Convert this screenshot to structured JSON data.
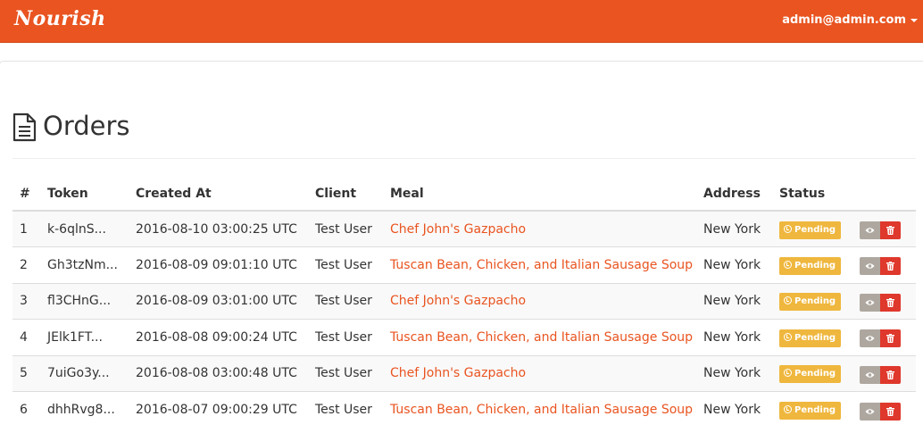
{
  "navbar": {
    "brand": "Nourish",
    "user_email": "admin@admin.com",
    "accent_color": "#e95420"
  },
  "page": {
    "title": "Orders",
    "title_icon": "file-text-icon"
  },
  "table": {
    "headers": [
      "#",
      "Token",
      "Created At",
      "Client",
      "Meal",
      "Address",
      "Status"
    ],
    "rows": [
      {
        "num": "1",
        "token": "k-6qlnS...",
        "created_at": "2016-08-10 03:00:25 UTC",
        "client": "Test User",
        "meal": "Chef John's Gazpacho",
        "address": "New York",
        "status": "Pending"
      },
      {
        "num": "2",
        "token": "Gh3tzNm...",
        "created_at": "2016-08-09 09:01:10 UTC",
        "client": "Test User",
        "meal": "Tuscan Bean, Chicken, and Italian Sausage Soup",
        "address": "New York",
        "status": "Pending"
      },
      {
        "num": "3",
        "token": "fl3CHnG...",
        "created_at": "2016-08-09 03:01:00 UTC",
        "client": "Test User",
        "meal": "Chef John's Gazpacho",
        "address": "New York",
        "status": "Pending"
      },
      {
        "num": "4",
        "token": "JElk1FT...",
        "created_at": "2016-08-08 09:00:24 UTC",
        "client": "Test User",
        "meal": "Tuscan Bean, Chicken, and Italian Sausage Soup",
        "address": "New York",
        "status": "Pending"
      },
      {
        "num": "5",
        "token": "7uiGo3y...",
        "created_at": "2016-08-08 03:00:48 UTC",
        "client": "Test User",
        "meal": "Chef John's Gazpacho",
        "address": "New York",
        "status": "Pending"
      },
      {
        "num": "6",
        "token": "dhhRvg8...",
        "created_at": "2016-08-07 09:00:29 UTC",
        "client": "Test User",
        "meal": "Tuscan Bean, Chicken, and Italian Sausage Soup",
        "address": "New York",
        "status": "Pending"
      }
    ],
    "status_color": "#efb73e",
    "view_icon": "eye-icon",
    "delete_icon": "trash-icon"
  }
}
